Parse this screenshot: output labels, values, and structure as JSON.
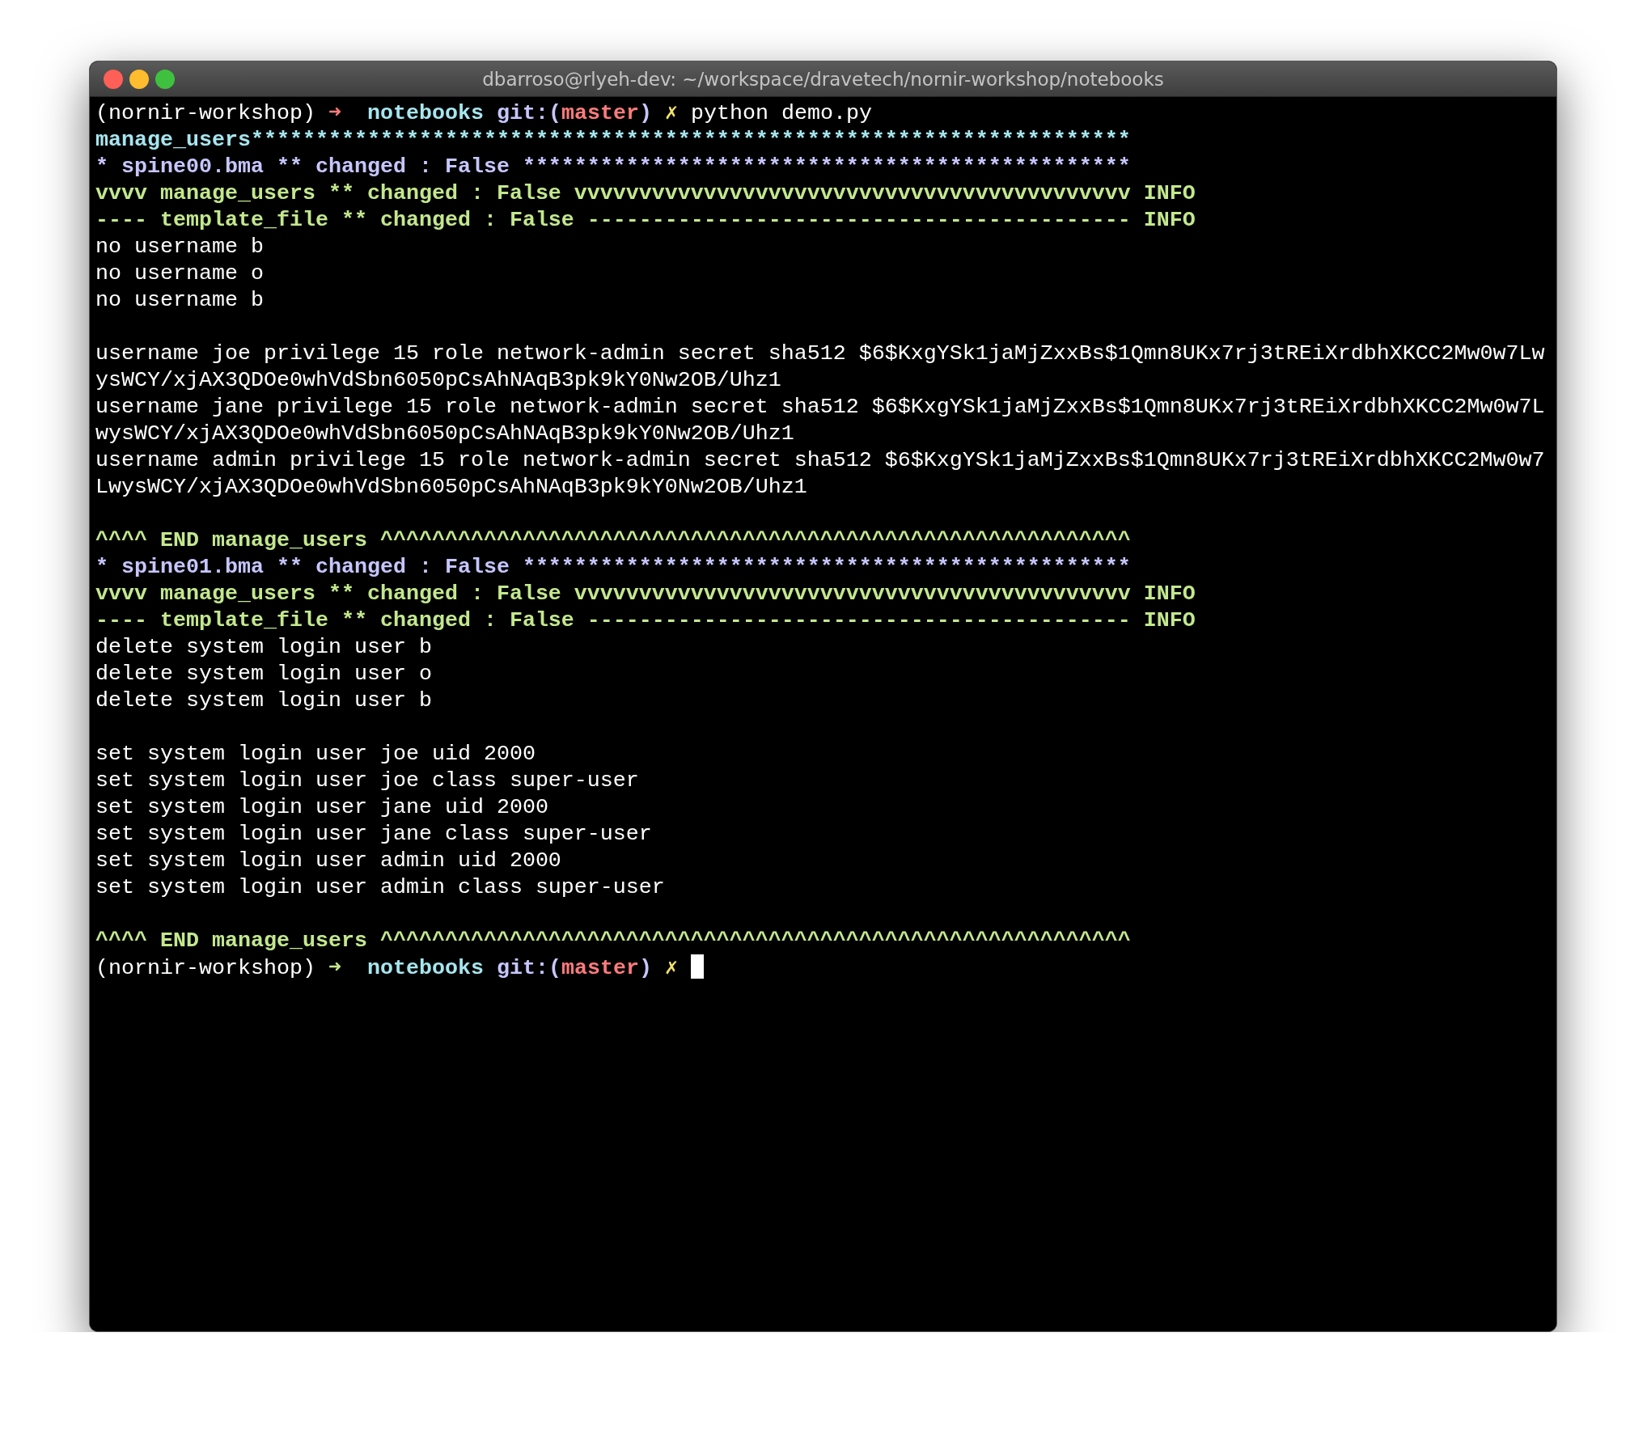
{
  "window": {
    "title": "dbarroso@rlyeh-dev: ~/workspace/dravetech/nornir-workshop/notebooks"
  },
  "lines": [
    {
      "kind": "text",
      "segments": [
        {
          "kind": "env",
          "text": "(nornir-workshop) ",
          "color": "#ffffff",
          "bold": false
        },
        {
          "kind": "arrow",
          "text": "➜  ",
          "color": "#ff7b7b"
        },
        {
          "kind": "dir",
          "text": "notebooks ",
          "color": "#a6e6ef",
          "bold": true
        },
        {
          "kind": "git",
          "text": "git:(",
          "color": "#c6c6ff",
          "bold": true
        },
        {
          "kind": "branch",
          "text": "master",
          "color": "#ff7b7b",
          "bold": true
        },
        {
          "kind": "git",
          "text": ") ",
          "color": "#c6c6ff",
          "bold": true
        },
        {
          "kind": "dirty",
          "text": "✗ ",
          "color": "#f2e36b"
        },
        {
          "kind": "command",
          "text": "python demo.py",
          "color": "#ffffff",
          "bold": false
        }
      ]
    },
    {
      "kind": "text",
      "segments": [
        {
          "kind": "header",
          "text": "manage_users********************************************************************",
          "color": "#a6e6ef",
          "bold": true
        }
      ]
    },
    {
      "kind": "text",
      "segments": [
        {
          "kind": "header",
          "text": "* spine00.bma ** changed : False ***********************************************",
          "color": "#c6c6ff",
          "bold": true
        }
      ]
    },
    {
      "kind": "text",
      "segments": [
        {
          "kind": "header",
          "text": "vvvv manage_users ** changed : False vvvvvvvvvvvvvvvvvvvvvvvvvvvvvvvvvvvvvvvvvvv INFO",
          "color": "#c3e88d",
          "bold": true
        }
      ]
    },
    {
      "kind": "text",
      "segments": [
        {
          "kind": "header",
          "text": "---- template_file ** changed : False ------------------------------------------ INFO",
          "color": "#c3e88d",
          "bold": true
        }
      ]
    },
    {
      "kind": "text",
      "segments": [
        {
          "kind": "output",
          "text": "no username b",
          "color": "#ffffff",
          "bold": false
        }
      ]
    },
    {
      "kind": "text",
      "segments": [
        {
          "kind": "output",
          "text": "no username o",
          "color": "#ffffff",
          "bold": false
        }
      ]
    },
    {
      "kind": "text",
      "segments": [
        {
          "kind": "output",
          "text": "no username b",
          "color": "#ffffff",
          "bold": false
        }
      ]
    },
    {
      "kind": "blank"
    },
    {
      "kind": "text",
      "segments": [
        {
          "kind": "output",
          "text": "username joe privilege 15 role network-admin secret sha512 $6$KxgYSk1jaMjZxxBs$1Qmn8UKx7rj3tREiXrdbhXKCC2Mw0w7LwysWCY/xjAX3QDOe0whVdSbn6050pCsAhNAqB3pk9kY0Nw2OB/Uhz1",
          "color": "#ffffff",
          "bold": false
        }
      ]
    },
    {
      "kind": "text",
      "segments": [
        {
          "kind": "output",
          "text": "username jane privilege 15 role network-admin secret sha512 $6$KxgYSk1jaMjZxxBs$1Qmn8UKx7rj3tREiXrdbhXKCC2Mw0w7LwysWCY/xjAX3QDOe0whVdSbn6050pCsAhNAqB3pk9kY0Nw2OB/Uhz1",
          "color": "#ffffff",
          "bold": false
        }
      ]
    },
    {
      "kind": "text",
      "segments": [
        {
          "kind": "output",
          "text": "username admin privilege 15 role network-admin secret sha512 $6$KxgYSk1jaMjZxxBs$1Qmn8UKx7rj3tREiXrdbhXKCC2Mw0w7LwysWCY/xjAX3QDOe0whVdSbn6050pCsAhNAqB3pk9kY0Nw2OB/Uhz1",
          "color": "#ffffff",
          "bold": false
        }
      ]
    },
    {
      "kind": "blank"
    },
    {
      "kind": "text",
      "segments": [
        {
          "kind": "header",
          "text": "^^^^ END manage_users ^^^^^^^^^^^^^^^^^^^^^^^^^^^^^^^^^^^^^^^^^^^^^^^^^^^^^^^^^^",
          "color": "#c3e88d",
          "bold": true
        }
      ]
    },
    {
      "kind": "text",
      "segments": [
        {
          "kind": "header",
          "text": "* spine01.bma ** changed : False ***********************************************",
          "color": "#c6c6ff",
          "bold": true
        }
      ]
    },
    {
      "kind": "text",
      "segments": [
        {
          "kind": "header",
          "text": "vvvv manage_users ** changed : False vvvvvvvvvvvvvvvvvvvvvvvvvvvvvvvvvvvvvvvvvvv INFO",
          "color": "#c3e88d",
          "bold": true
        }
      ]
    },
    {
      "kind": "text",
      "segments": [
        {
          "kind": "header",
          "text": "---- template_file ** changed : False ------------------------------------------ INFO",
          "color": "#c3e88d",
          "bold": true
        }
      ]
    },
    {
      "kind": "text",
      "segments": [
        {
          "kind": "output",
          "text": "delete system login user b",
          "color": "#ffffff",
          "bold": false
        }
      ]
    },
    {
      "kind": "text",
      "segments": [
        {
          "kind": "output",
          "text": "delete system login user o",
          "color": "#ffffff",
          "bold": false
        }
      ]
    },
    {
      "kind": "text",
      "segments": [
        {
          "kind": "output",
          "text": "delete system login user b",
          "color": "#ffffff",
          "bold": false
        }
      ]
    },
    {
      "kind": "blank"
    },
    {
      "kind": "text",
      "segments": [
        {
          "kind": "output",
          "text": "set system login user joe uid 2000",
          "color": "#ffffff",
          "bold": false
        }
      ]
    },
    {
      "kind": "text",
      "segments": [
        {
          "kind": "output",
          "text": "set system login user joe class super-user",
          "color": "#ffffff",
          "bold": false
        }
      ]
    },
    {
      "kind": "text",
      "segments": [
        {
          "kind": "output",
          "text": "set system login user jane uid 2000",
          "color": "#ffffff",
          "bold": false
        }
      ]
    },
    {
      "kind": "text",
      "segments": [
        {
          "kind": "output",
          "text": "set system login user jane class super-user",
          "color": "#ffffff",
          "bold": false
        }
      ]
    },
    {
      "kind": "text",
      "segments": [
        {
          "kind": "output",
          "text": "set system login user admin uid 2000",
          "color": "#ffffff",
          "bold": false
        }
      ]
    },
    {
      "kind": "text",
      "segments": [
        {
          "kind": "output",
          "text": "set system login user admin class super-user",
          "color": "#ffffff",
          "bold": false
        }
      ]
    },
    {
      "kind": "blank"
    },
    {
      "kind": "text",
      "segments": [
        {
          "kind": "header",
          "text": "^^^^ END manage_users ^^^^^^^^^^^^^^^^^^^^^^^^^^^^^^^^^^^^^^^^^^^^^^^^^^^^^^^^^^",
          "color": "#c3e88d",
          "bold": true
        }
      ]
    },
    {
      "kind": "text",
      "segments": [
        {
          "kind": "env",
          "text": "(nornir-workshop) ",
          "color": "#ffffff",
          "bold": false
        },
        {
          "kind": "arrow",
          "text": "➜  ",
          "color": "#c3e88d"
        },
        {
          "kind": "dir",
          "text": "notebooks ",
          "color": "#a6e6ef",
          "bold": true
        },
        {
          "kind": "git",
          "text": "git:(",
          "color": "#c6c6ff",
          "bold": true
        },
        {
          "kind": "branch",
          "text": "master",
          "color": "#ff7b7b",
          "bold": true
        },
        {
          "kind": "git",
          "text": ") ",
          "color": "#c6c6ff",
          "bold": true
        },
        {
          "kind": "dirty",
          "text": "✗ ",
          "color": "#f2e36b"
        },
        {
          "kind": "cursor",
          "color": "#ffffff"
        }
      ]
    }
  ]
}
